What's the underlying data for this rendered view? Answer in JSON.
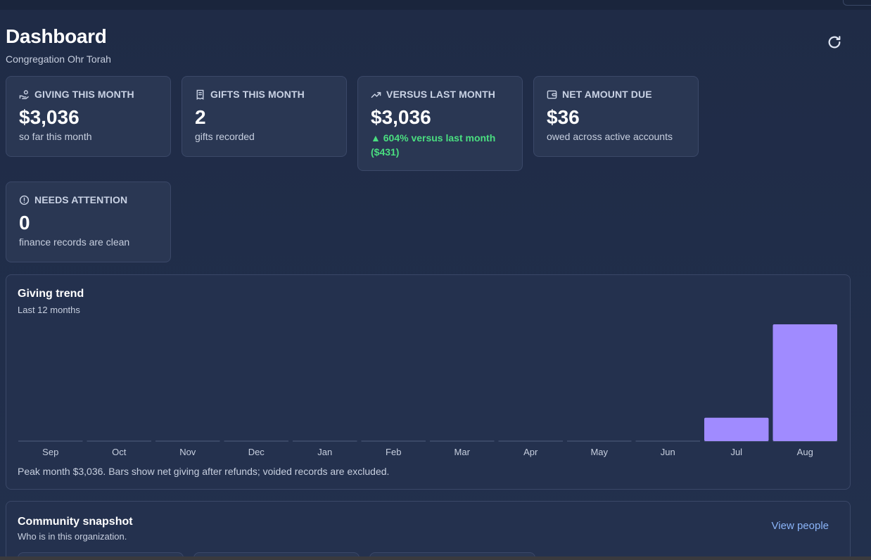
{
  "header": {
    "title": "Dashboard",
    "subtitle": "Congregation Ohr Torah"
  },
  "icons": {
    "refresh": "refresh-icon",
    "giving": "hand-coins-icon",
    "gifts": "receipt-icon",
    "versus": "trending-up-icon",
    "due": "wallet-icon",
    "attention": "alert-circle-icon"
  },
  "colors": {
    "accent_bar": "#a08bff",
    "positive": "#4ade80",
    "link": "#8ab4f8"
  },
  "cards": [
    {
      "label": "GIVING THIS MONTH",
      "value": "$3,036",
      "sub": "so far this month"
    },
    {
      "label": "GIFTS THIS MONTH",
      "value": "2",
      "sub": "gifts recorded"
    },
    {
      "label": "VERSUS LAST MONTH",
      "value": "$3,036",
      "sub_line1": "▲ 604% versus last month",
      "sub_line2": "($431)"
    },
    {
      "label": "NET AMOUNT DUE",
      "value": "$36",
      "sub": "owed across active accounts"
    },
    {
      "label": "NEEDS ATTENTION",
      "value": "0",
      "sub": "finance records are clean"
    }
  ],
  "trend": {
    "title": "Giving trend",
    "subtitle": "Last 12 months",
    "footnote": "Peak month $3,036. Bars show net giving after refunds; voided records are excluded."
  },
  "chart_data": {
    "type": "bar",
    "categories": [
      "Sep",
      "Oct",
      "Nov",
      "Dec",
      "Jan",
      "Feb",
      "Mar",
      "Apr",
      "May",
      "Jun",
      "Jul",
      "Aug"
    ],
    "values": [
      0,
      0,
      0,
      0,
      0,
      0,
      0,
      0,
      0,
      0,
      608,
      3036
    ],
    "title": "Giving trend",
    "subtitle": "Last 12 months",
    "ylim": [
      0,
      3036
    ],
    "grid": false,
    "legend": "none"
  },
  "community": {
    "title": "Community snapshot",
    "subtitle": "Who is in this organization.",
    "link_label": "View people"
  }
}
